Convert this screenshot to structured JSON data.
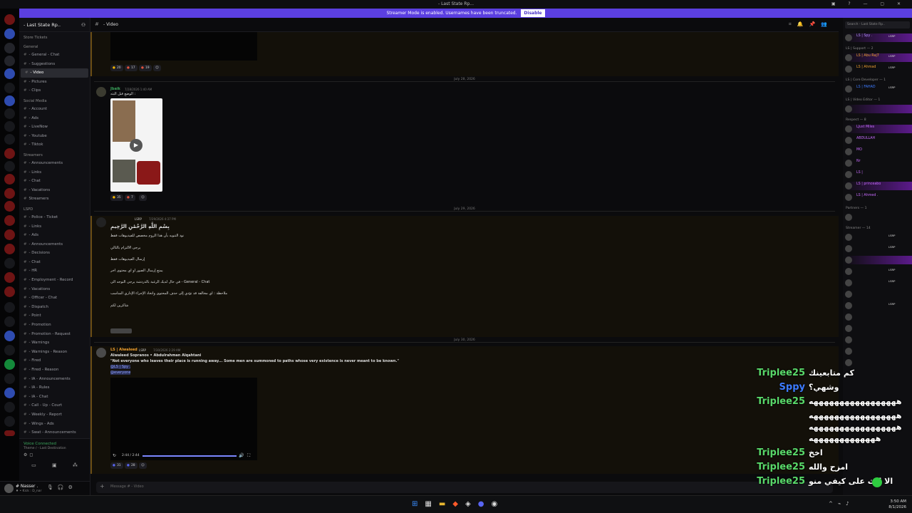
{
  "window": {
    "title": "- Last State Rp..."
  },
  "streamer_bar": {
    "message": "Streamer Mode is enabled. Usernames have been truncated.",
    "disable": "Disable"
  },
  "server": {
    "name": "- Last State Rp.."
  },
  "channels": [
    {
      "type": "cat",
      "label": "Store Tickets"
    },
    {
      "type": "cat",
      "label": "General"
    },
    {
      "type": "ch",
      "label": "- General - Chat"
    },
    {
      "type": "ch",
      "label": "- Suggestions"
    },
    {
      "type": "ch",
      "label": "- Video",
      "active": true
    },
    {
      "type": "ch",
      "label": "- Pictures"
    },
    {
      "type": "ch",
      "label": "- Clips"
    },
    {
      "type": "cat",
      "label": "Social Media"
    },
    {
      "type": "ch",
      "label": "- Account"
    },
    {
      "type": "ch",
      "label": "- Ads"
    },
    {
      "type": "ch",
      "label": "- LiveNow"
    },
    {
      "type": "ch",
      "label": "- Youtube"
    },
    {
      "type": "ch",
      "label": "- Tiktok"
    },
    {
      "type": "cat",
      "label": "Streamers"
    },
    {
      "type": "ch",
      "label": "- Announcements"
    },
    {
      "type": "ch",
      "label": "- Links"
    },
    {
      "type": "ch",
      "label": "- Chat"
    },
    {
      "type": "ch",
      "label": "- Vacations"
    },
    {
      "type": "ch",
      "label": "Streamers"
    },
    {
      "type": "cat",
      "label": "LSPD"
    },
    {
      "type": "ch",
      "label": "- Police - Ticket"
    },
    {
      "type": "ch",
      "label": "- Links"
    },
    {
      "type": "ch",
      "label": "- Ads"
    },
    {
      "type": "ch",
      "label": "- Announcements"
    },
    {
      "type": "ch",
      "label": "- Decisions"
    },
    {
      "type": "ch",
      "label": "- Chat"
    },
    {
      "type": "ch",
      "label": "- HR"
    },
    {
      "type": "ch",
      "label": "- Employment - Record"
    },
    {
      "type": "ch",
      "label": "- Vacations"
    },
    {
      "type": "ch",
      "label": "- Officer - Chat"
    },
    {
      "type": "ch",
      "label": "- Dispatch"
    },
    {
      "type": "ch",
      "label": "- Point"
    },
    {
      "type": "ch",
      "label": "- Promotion"
    },
    {
      "type": "ch",
      "label": "- Promotion - Request"
    },
    {
      "type": "ch",
      "label": "- Warnings"
    },
    {
      "type": "ch",
      "label": "- Warnings - Reason"
    },
    {
      "type": "ch",
      "label": "- Fired"
    },
    {
      "type": "ch",
      "label": "- Fired - Reason"
    },
    {
      "type": "ch",
      "label": "- IA - Announcements"
    },
    {
      "type": "ch",
      "label": "- IA - Rules"
    },
    {
      "type": "ch",
      "label": "- IA - Chat"
    },
    {
      "type": "ch",
      "label": "- Call - Up - Court"
    },
    {
      "type": "ch",
      "label": "- Weekly - Report"
    },
    {
      "type": "ch",
      "label": "- Wings - Ads"
    },
    {
      "type": "ch",
      "label": "- Swat - Announcements"
    }
  ],
  "voice": {
    "status": "Voice Connected",
    "channel": "Theme / - Last Destination"
  },
  "user": {
    "name": "# Nasser .",
    "status": "♦ • Kick : D_nar"
  },
  "channel_header": {
    "title": "- Video"
  },
  "messages": {
    "m1_reactions": [
      "20",
      "17",
      "19"
    ],
    "date1": "July 28, 2026",
    "m2_author": "Jbaik",
    "m2_time": "7/28/2026 1:40 AM",
    "m2_text": "الوضع قبل البثه :",
    "m2_reactions": [
      "35",
      "7"
    ],
    "date2": "July 29, 2026",
    "m3_tag": "LSRP",
    "m3_time": "7/29/2026 4:37 PM",
    "m3_lines": [
      "بِسْمِ اللَّهِ الرَّحْمَٰنِ الرَّحِيمِ",
      "نود التنويه بأن هذا الروم مخصص للفيديوهات فقط",
      "يرجى الالتزام بالتالي",
      "إرسال الفيديوهات فقط",
      "يمنع إرسال الصور او اي محتوى اخر",
      "في حال لديك الرغبة بالدردشة يرجى التوجه الى   - General - Chat",
      "ملاحظة : اي مخالفة قد تؤدي إلى حذف المحتوى واتخاذ الإجراء الإداري المناسب",
      "شاكرين لكم"
    ],
    "date3": "July 30, 2026",
    "m4_author": "LS | Alwaleed",
    "m4_tag": "LSRP",
    "m4_time": "7/30/2026 2:29 AM",
    "m4_line1": "Alwaleed Sopranos • Abdulrahman Alqahtani",
    "m4_line2": "\"Not everyone who leaves their place is running away... Some men are summoned to paths whose very existence is never meant to be known.\"",
    "m4_mention1": "@LS | Spy .",
    "m4_mention2": "@everyone",
    "m4_video_time": "2:44 / 2:44",
    "m4_reactions": [
      "31",
      "28"
    ]
  },
  "composer": {
    "placeholder": "Message # - Video"
  },
  "members": {
    "search_placeholder": "Search - Last State Rp..",
    "rows": [
      {
        "type": "row",
        "name": "LS | Spy .",
        "tag": "LSRP",
        "color": "#b48cff",
        "hl": true
      },
      {
        "type": "cat",
        "label": "LS | Support — 2"
      },
      {
        "type": "row",
        "name": "LS | Abu Raj7",
        "tag": "LSRP",
        "color": "#f0a030",
        "hl": true
      },
      {
        "type": "row",
        "name": "LS | Ahmad",
        "tag": "LSRP",
        "color": "#f0a030"
      },
      {
        "type": "cat",
        "label": "LS | Core Developer — 1"
      },
      {
        "type": "row",
        "name": "LS | FAHAD",
        "tag": "LSRP",
        "color": "#3d7bff"
      },
      {
        "type": "cat",
        "label": "LS | Video Editor — 1"
      },
      {
        "type": "row",
        "name": "",
        "tag": "",
        "color": "#b48cff",
        "hl": true
      },
      {
        "type": "cat",
        "label": "Respect — 8"
      },
      {
        "type": "row",
        "name": "LJust Miles",
        "tag": "",
        "color": "#c86bff",
        "hl": true
      },
      {
        "type": "row",
        "name": "ABDULLAH",
        "tag": "",
        "color": "#c86bff"
      },
      {
        "type": "row",
        "name": "MO",
        "tag": "",
        "color": "#c86bff"
      },
      {
        "type": "row",
        "name": "Nr",
        "tag": "",
        "color": "#c86bff"
      },
      {
        "type": "row",
        "name": "LS |",
        "tag": "",
        "color": "#c86bff"
      },
      {
        "type": "row",
        "name": "LS | princeabo",
        "tag": "",
        "color": "#c86bff",
        "hl": true
      },
      {
        "type": "row",
        "name": "LS | Ahmed .",
        "tag": "",
        "color": "#c86bff"
      },
      {
        "type": "cat",
        "label": "Partners — 1"
      },
      {
        "type": "row",
        "name": "",
        "tag": "",
        "color": "#e04040"
      },
      {
        "type": "cat",
        "label": "Streamer — 14"
      },
      {
        "type": "row",
        "name": "",
        "tag": "LSRP",
        "color": "#3d7bff"
      },
      {
        "type": "row",
        "name": "",
        "tag": "LSRP",
        "color": "#3d7bff"
      },
      {
        "type": "row",
        "name": "",
        "tag": "",
        "color": "#c86bff",
        "hl": true
      },
      {
        "type": "row",
        "name": "",
        "tag": "LSRP",
        "color": "#3d7bff"
      },
      {
        "type": "row",
        "name": "",
        "tag": "LSRP",
        "color": "#3d7bff"
      },
      {
        "type": "row",
        "name": "",
        "tag": "",
        "color": "#3d7bff"
      },
      {
        "type": "row",
        "name": "",
        "tag": "LSRP",
        "color": "#3d7bff"
      },
      {
        "type": "row",
        "name": "",
        "tag": "",
        "color": "#3d7bff"
      },
      {
        "type": "row",
        "name": "",
        "tag": "",
        "color": "#3d7bff"
      },
      {
        "type": "row",
        "name": "",
        "tag": "",
        "color": "#3d7bff"
      },
      {
        "type": "row",
        "name": "",
        "tag": "",
        "color": "#3d7bff"
      },
      {
        "type": "row",
        "name": "",
        "tag": "",
        "color": "#3d7bff"
      }
    ]
  },
  "stream_chat": [
    {
      "name": "Triplee25",
      "msg": "كم متابعينك",
      "blue": false
    },
    {
      "name": "Sppy",
      "msg": "وشهي؟",
      "blue": true
    },
    {
      "name": "Triplee25",
      "msg": "هههههههههههههههههه",
      "blue": false
    },
    {
      "name": "",
      "msg": "هههههههههههههههههه",
      "blue": false
    },
    {
      "name": "",
      "msg": "هههههههههههههههههه",
      "blue": false
    },
    {
      "name": "",
      "msg": "هههههههههههههه",
      "blue": false
    },
    {
      "name": "Triplee25",
      "msg": "اخخ",
      "blue": false
    },
    {
      "name": "Triplee25",
      "msg": "امزح والله",
      "blue": false
    },
    {
      "name": "Triplee25",
      "msg": "الا ابث على كيفي منو",
      "blue": false
    }
  ],
  "taskbar": {
    "time": "3:50 AM",
    "date": "8/1/2026"
  }
}
